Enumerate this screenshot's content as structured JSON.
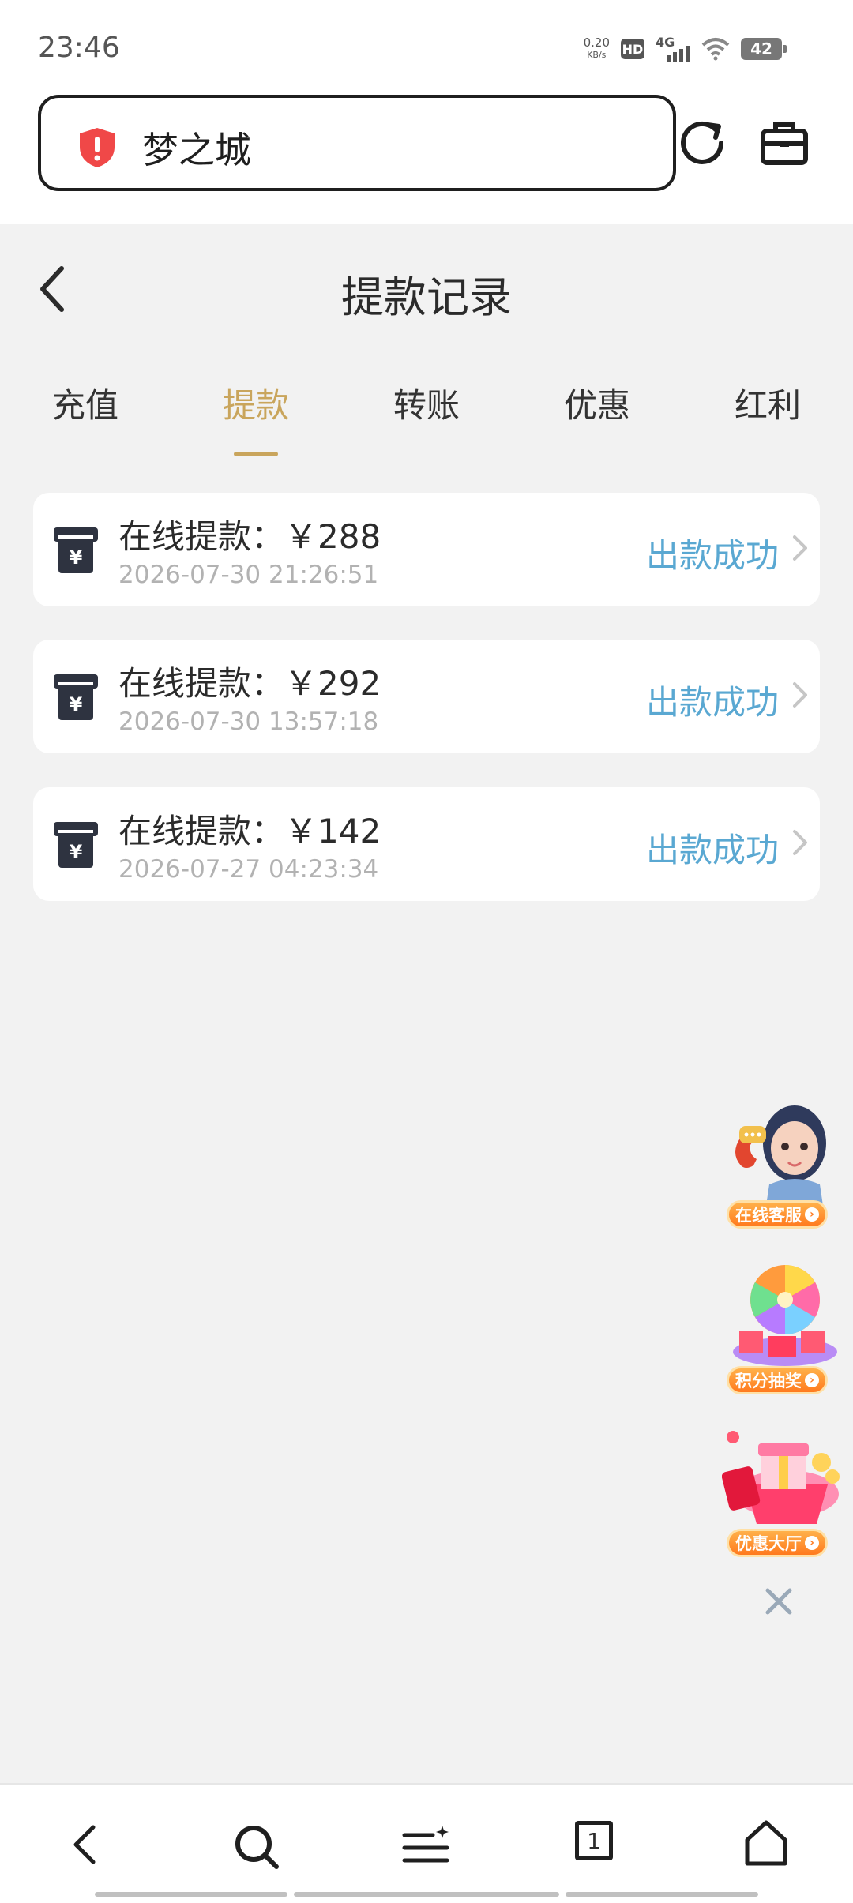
{
  "status_bar": {
    "time": "23:46",
    "net_speed_value": "0.20",
    "net_speed_unit": "KB/s",
    "hd": "HD",
    "network": "4G",
    "battery": "42"
  },
  "browser": {
    "url_title": "梦之城",
    "security_icon": "shield-alert-icon",
    "reload_icon": "reload-icon",
    "toolbox_icon": "toolbox-icon"
  },
  "page": {
    "title": "提款记录",
    "back_icon": "back-arrow-icon"
  },
  "tabs": [
    {
      "label": "充值",
      "active": false
    },
    {
      "label": "提款",
      "active": true
    },
    {
      "label": "转账",
      "active": false
    },
    {
      "label": "优惠",
      "active": false
    },
    {
      "label": "红利",
      "active": false
    }
  ],
  "records": [
    {
      "title": "在线提款：￥288",
      "time": "2026-07-30 21:26:51",
      "status": "出款成功"
    },
    {
      "title": "在线提款：￥292",
      "time": "2026-07-30 13:57:18",
      "status": "出款成功"
    },
    {
      "title": "在线提款：￥142",
      "time": "2026-07-27 04:23:34",
      "status": "出款成功"
    }
  ],
  "floating_widgets": [
    {
      "label": "在线客服",
      "icon": "customer-service-agent-icon"
    },
    {
      "label": "积分抽奖",
      "icon": "prize-wheel-icon"
    },
    {
      "label": "优惠大厅",
      "icon": "gift-box-icon"
    }
  ],
  "bottom_nav": {
    "tab_count": "1",
    "icons": [
      "back-icon",
      "search-icon",
      "menu-icon",
      "tabs-icon",
      "home-icon"
    ]
  },
  "colors": {
    "accent": "#c9a55c",
    "status_success": "#5aa8d2",
    "background": "#f2f2f2"
  }
}
